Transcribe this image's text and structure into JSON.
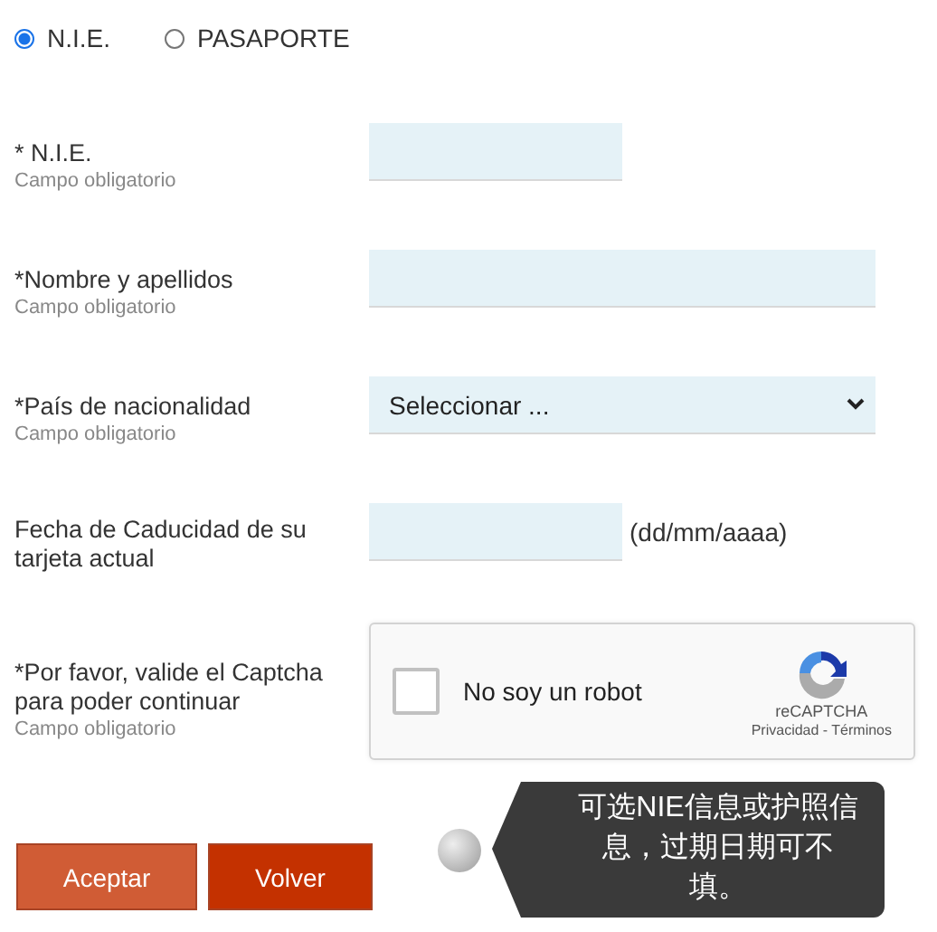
{
  "id_type": [
    {
      "label": "N.I.E.",
      "selected": true
    },
    {
      "label": "PASAPORTE",
      "selected": false
    }
  ],
  "fields": [
    {
      "kind": "text",
      "label": "* N.I.E.",
      "note": "Campo obligatorio"
    },
    {
      "kind": "wide_text",
      "label": "*Nombre y apellidos",
      "note": "Campo obligatorio"
    },
    {
      "kind": "select",
      "label": "*País de nacionalidad",
      "note": "Campo obligatorio",
      "value": "Seleccionar ..."
    },
    {
      "kind": "date",
      "label": "Fecha de Caducidad de su tarjeta actual",
      "hint": "(dd/mm/aaaa)"
    },
    {
      "kind": "captcha",
      "label": "*Por favor, valide el Captcha para poder continuar",
      "note": "Campo obligatorio",
      "checkbox_label": "No soy un robot",
      "checked": false,
      "brand": "reCAPTCHA",
      "links": "Privacidad - Términos"
    }
  ],
  "buttons": [
    {
      "label": "Aceptar",
      "kind": "primary"
    },
    {
      "label": "Volver",
      "kind": "secondary"
    }
  ],
  "tooltip": {
    "text": "可选NIE信息或护照信息，过期日期可不填。"
  }
}
